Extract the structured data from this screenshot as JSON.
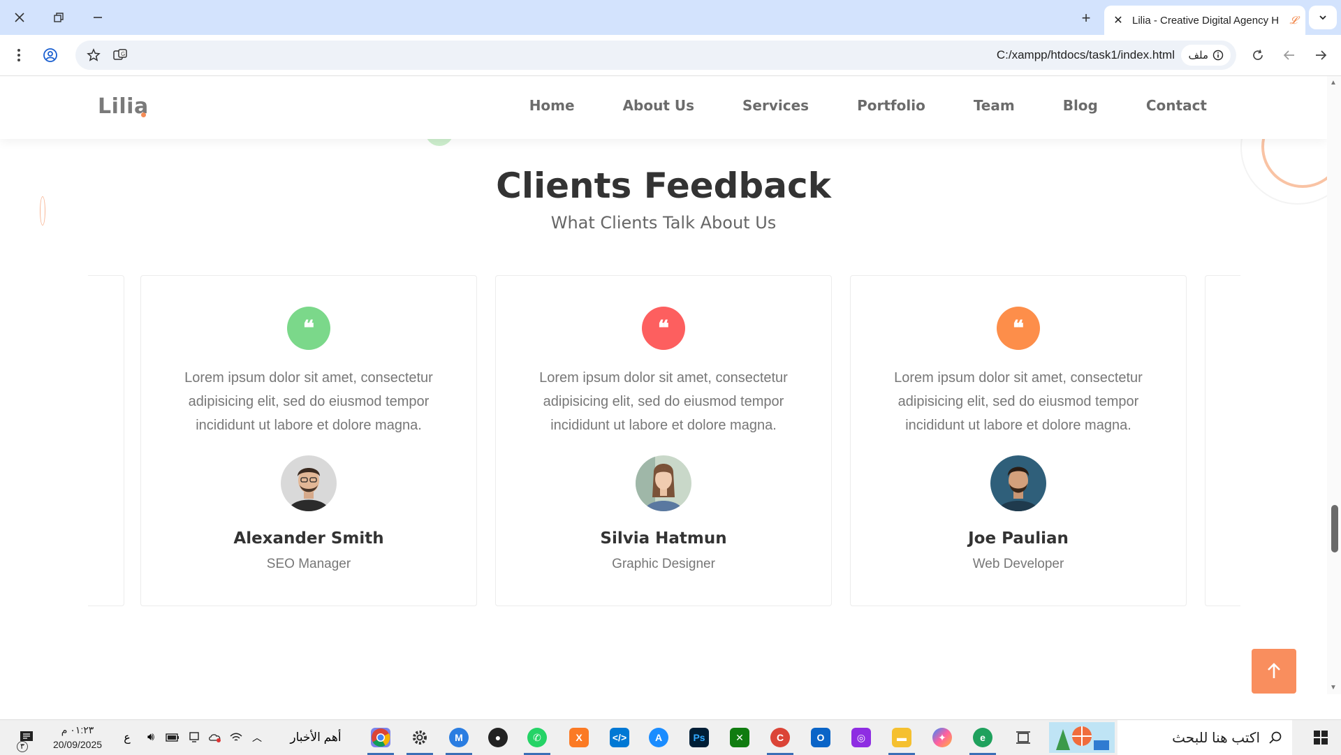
{
  "browser": {
    "tab_title": "Lilia - Creative Digital Agency H",
    "tab_favicon": "𝓛",
    "url": "C:/xampp/htdocs/task1/index.html",
    "url_chip_label": "ملف"
  },
  "site": {
    "logo": "Lilia",
    "nav": [
      "Home",
      "About Us",
      "Services",
      "Portfolio",
      "Team",
      "Blog",
      "Contact"
    ]
  },
  "feedback": {
    "title": "Clients Feedback",
    "subtitle": "What Clients Talk About Us",
    "cards": [
      {
        "quote": "Lorem ipsum dolor sit amet, consectetur adipisicing elit, sed do eiusmod tempor incididunt ut labore et dolore magna.",
        "name": "Alexander Smith",
        "role": "SEO Manager",
        "icon_color": "#7bd88a"
      },
      {
        "quote": "Lorem ipsum dolor sit amet, consectetur adipisicing elit, sed do eiusmod tempor incididunt ut labore et dolore magna.",
        "name": "Silvia Hatmun",
        "role": "Graphic Designer",
        "icon_color": "#fd5f5f"
      },
      {
        "quote": "Lorem ipsum dolor sit amet, consectetur adipisicing elit, sed do eiusmod tempor incididunt ut labore et dolore magna.",
        "name": "Joe Paulian",
        "role": "Web Developer",
        "icon_color": "#fd8e4a"
      }
    ]
  },
  "colors": {
    "accent": "#f98e5e",
    "chrome_bg": "#d3e3fd"
  },
  "taskbar": {
    "time": "٠١:٢٣ م",
    "date": "20/09/2025",
    "lang": "ع",
    "news_label": "أهم الأخبار",
    "search_placeholder": "اكتب هنا للبحث",
    "notification_count": "٣"
  }
}
